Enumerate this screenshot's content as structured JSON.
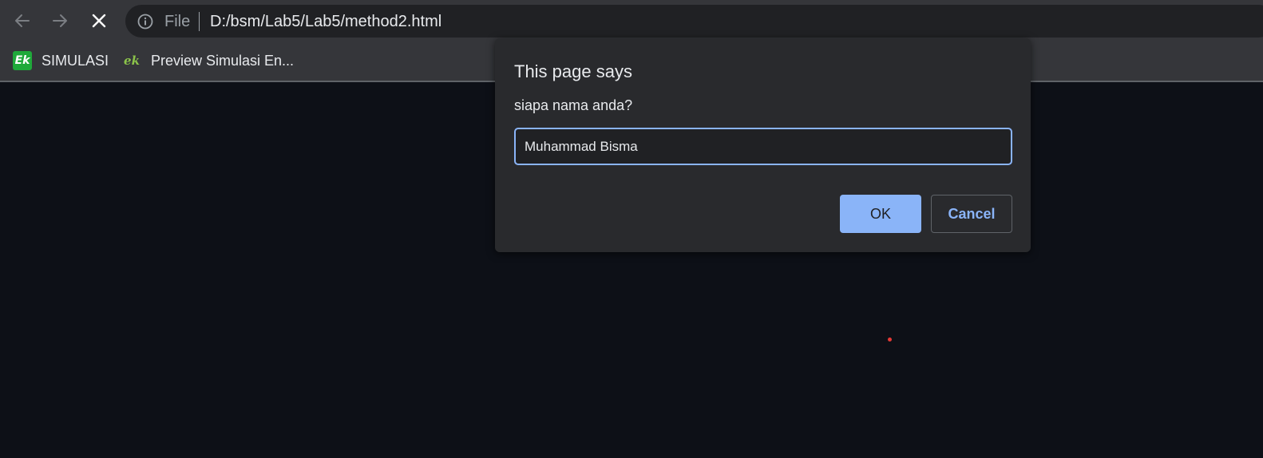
{
  "browser": {
    "address_bar": {
      "scheme_label": "File",
      "url": "D:/bsm/Lab5/Lab5/method2.html"
    },
    "bookmarks": [
      {
        "label": "SIMULASI",
        "icon": "ek-logo-icon",
        "icon_text": "Ek",
        "icon_color": "#1fa93a"
      },
      {
        "label": "Preview Simulasi En...",
        "icon": "ek-leaf-icon",
        "icon_text": "ek",
        "icon_color": "#8bc34a"
      }
    ],
    "nav": {
      "back_icon": "arrow-left-icon",
      "forward_icon": "arrow-right-icon",
      "stop_icon": "close-icon"
    }
  },
  "dialog": {
    "title": "This page says",
    "message": "siapa nama anda?",
    "input_value": "Muhammad Bisma",
    "ok_label": "OK",
    "cancel_label": "Cancel"
  },
  "colors": {
    "accent": "#8ab4f8",
    "page_background": "#0d1017",
    "dialog_background": "#292a2d",
    "red_dot": "#e53935"
  }
}
